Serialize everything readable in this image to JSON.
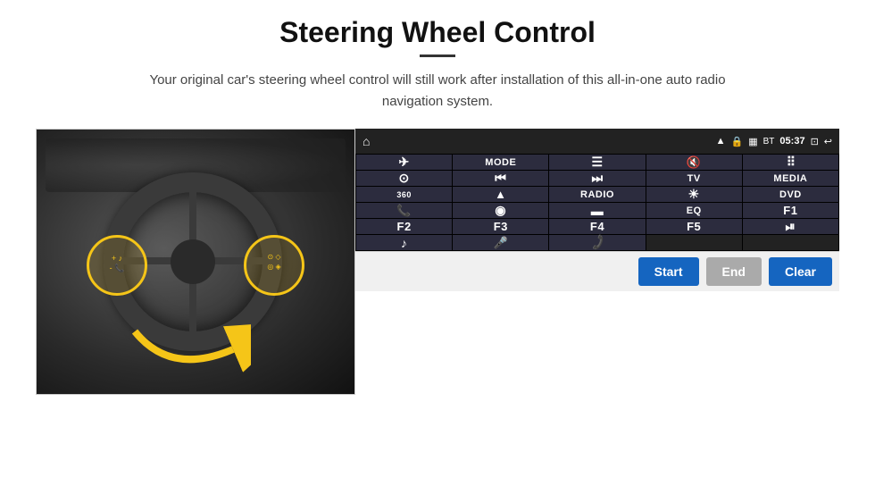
{
  "header": {
    "title": "Steering Wheel Control",
    "subtitle": "Your original car's steering wheel control will still work after installation of this all-in-one auto radio navigation system."
  },
  "statusBar": {
    "home_icon": "⌂",
    "wifi_icon": "WiFi",
    "lock_icon": "🔒",
    "sd_icon": "SD",
    "bluetooth_icon": "BT",
    "time": "05:37",
    "window_icon": "⊡",
    "back_icon": "↩"
  },
  "buttons": [
    {
      "id": "r1c1",
      "icon": "✈",
      "text": "",
      "type": "icon"
    },
    {
      "id": "r1c2",
      "icon": "",
      "text": "MODE",
      "type": "text"
    },
    {
      "id": "r1c3",
      "icon": "≡",
      "text": "",
      "type": "icon"
    },
    {
      "id": "r1c4",
      "icon": "🔇",
      "text": "",
      "type": "icon"
    },
    {
      "id": "r1c5",
      "icon": "⠿",
      "text": "",
      "type": "icon"
    },
    {
      "id": "r2c1",
      "icon": "⊙",
      "text": "",
      "type": "icon"
    },
    {
      "id": "r2c2",
      "icon": "⏮",
      "text": "",
      "type": "icon"
    },
    {
      "id": "r2c3",
      "icon": "⏭",
      "text": "",
      "type": "icon"
    },
    {
      "id": "r2c4",
      "icon": "",
      "text": "TV",
      "type": "text"
    },
    {
      "id": "r2c5",
      "icon": "",
      "text": "MEDIA",
      "type": "text"
    },
    {
      "id": "r3c1",
      "icon": "360",
      "text": "",
      "type": "icon-text"
    },
    {
      "id": "r3c2",
      "icon": "▲",
      "text": "",
      "type": "icon"
    },
    {
      "id": "r3c3",
      "icon": "",
      "text": "RADIO",
      "type": "text"
    },
    {
      "id": "r3c4",
      "icon": "☀",
      "text": "",
      "type": "icon"
    },
    {
      "id": "r3c5",
      "icon": "",
      "text": "DVD",
      "type": "text"
    },
    {
      "id": "r4c1",
      "icon": "📞",
      "text": "",
      "type": "icon"
    },
    {
      "id": "r4c2",
      "icon": "◎",
      "text": "",
      "type": "icon"
    },
    {
      "id": "r4c3",
      "icon": "▭",
      "text": "",
      "type": "icon"
    },
    {
      "id": "r4c4",
      "icon": "",
      "text": "EQ",
      "type": "text"
    },
    {
      "id": "r4c5",
      "icon": "",
      "text": "F1",
      "type": "text"
    },
    {
      "id": "r5c1",
      "icon": "",
      "text": "F2",
      "type": "text"
    },
    {
      "id": "r5c2",
      "icon": "",
      "text": "F3",
      "type": "text"
    },
    {
      "id": "r5c3",
      "icon": "",
      "text": "F4",
      "type": "text"
    },
    {
      "id": "r5c4",
      "icon": "",
      "text": "F5",
      "type": "text"
    },
    {
      "id": "r5c5",
      "icon": "⏯",
      "text": "",
      "type": "icon"
    },
    {
      "id": "r6c1",
      "icon": "♪",
      "text": "",
      "type": "icon"
    },
    {
      "id": "r6c2",
      "icon": "🎤",
      "text": "",
      "type": "icon"
    },
    {
      "id": "r6c3",
      "icon": "📞",
      "text": "",
      "type": "icon"
    },
    {
      "id": "r6c4",
      "icon": "",
      "text": "",
      "type": "empty"
    },
    {
      "id": "r6c5",
      "icon": "",
      "text": "",
      "type": "empty"
    }
  ],
  "actionBar": {
    "start_label": "Start",
    "end_label": "End",
    "clear_label": "Clear"
  }
}
